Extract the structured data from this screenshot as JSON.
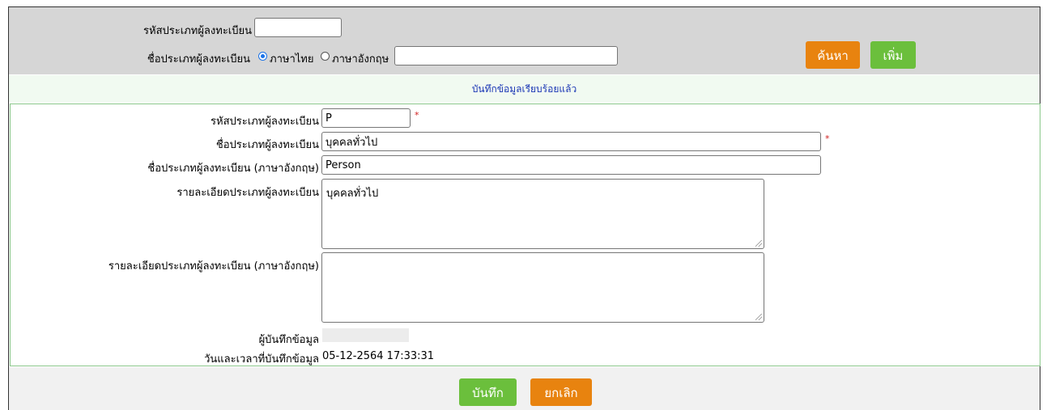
{
  "search": {
    "code_label": "รหัสประเภทผู้ลงทะเบียน",
    "code_value": "",
    "name_label": "ชื่อประเภทผู้ลงทะเบียน",
    "lang_thai": "ภาษาไทย",
    "lang_english": "ภาษาอังกฤษ",
    "selected_lang": "ภาษาไทย",
    "name_value": "",
    "search_button": "ค้นหา",
    "add_button": "เพิ่ม"
  },
  "message": "บันทึกข้อมูลเรียบร้อยแล้ว",
  "form": {
    "code_label": "รหัสประเภทผู้ลงทะเบียน",
    "code_value": "P",
    "name_label": "ชื่อประเภทผู้ลงทะเบียน",
    "name_value": "บุคคลทั่วไป",
    "name_en_label": "ชื่อประเภทผู้ลงทะเบียน (ภาษาอังกฤษ)",
    "name_en_value": "Person",
    "detail_label": "รายละเอียดประเภทผู้ลงทะเบียน",
    "detail_value": "บุคคลทั่วไป",
    "detail_en_label": "รายละเอียดประเภทผู้ลงทะเบียน (ภาษาอังกฤษ)",
    "detail_en_value": "",
    "recorder_label": "ผู้บันทึกข้อมูล",
    "recorder_value": "",
    "datetime_label": "วันและเวลาที่บันทึกข้อมูล",
    "datetime_value": "05-12-2564 17:33:31",
    "required_mark": "*"
  },
  "actions": {
    "save_button": "บันทึก",
    "cancel_button": "ยกเลิก"
  },
  "colors": {
    "search_panel_bg": "#d6d6d6",
    "message_text": "#1a36b5",
    "orange_button": "#e8830f",
    "green_button": "#6bbf3c",
    "form_border": "#8bc88b",
    "required": "#d02020"
  }
}
